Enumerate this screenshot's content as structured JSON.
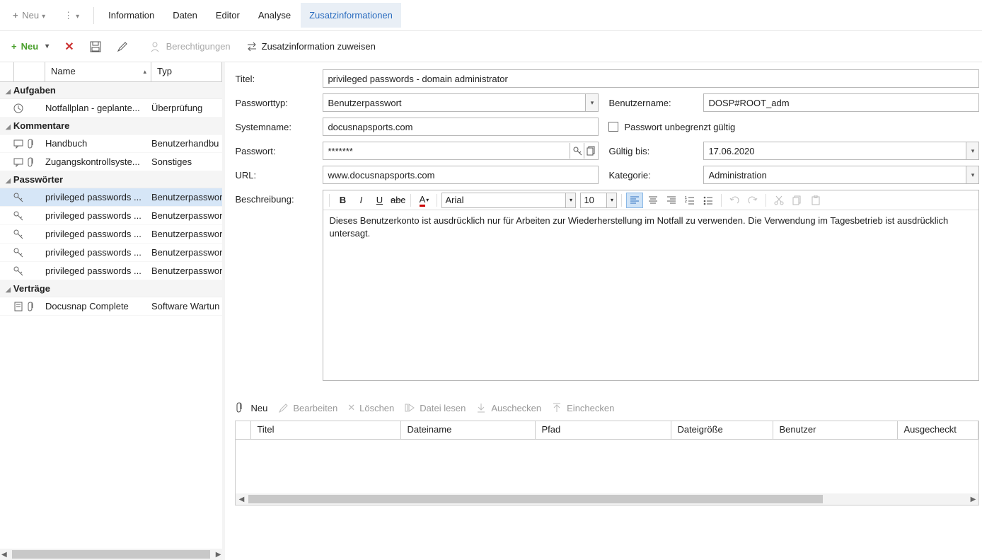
{
  "menubar": {
    "neu": "Neu",
    "information": "Information",
    "daten": "Daten",
    "editor": "Editor",
    "analyse": "Analyse",
    "zusatz": "Zusatzinformationen"
  },
  "toolbar": {
    "neu": "Neu",
    "berechtigungen": "Berechtigungen",
    "zuweisen": "Zusatzinformation zuweisen"
  },
  "sidebar": {
    "headers": {
      "name": "Name",
      "typ": "Typ"
    },
    "groups": {
      "aufgaben": "Aufgaben",
      "kommentare": "Kommentare",
      "passwoerter": "Passwörter",
      "vertraege": "Verträge"
    },
    "items": {
      "notfall": {
        "name": "Notfallplan - geplante...",
        "typ": "Überprüfung"
      },
      "handbuch": {
        "name": "Handbuch",
        "typ": "Benutzerhandbu"
      },
      "zugang": {
        "name": "Zugangskontrollsyste...",
        "typ": "Sonstiges"
      },
      "pw1": {
        "name": "privileged passwords ...",
        "typ": "Benutzerpasswor"
      },
      "pw2": {
        "name": "privileged passwords ...",
        "typ": "Benutzerpasswor"
      },
      "pw3": {
        "name": "privileged passwords ...",
        "typ": "Benutzerpasswor"
      },
      "pw4": {
        "name": "privileged passwords ...",
        "typ": "Benutzerpasswor"
      },
      "pw5": {
        "name": "privileged passwords ...",
        "typ": "Benutzerpasswor"
      },
      "docusnap": {
        "name": "Docusnap Complete",
        "typ": "Software Wartun"
      }
    }
  },
  "form": {
    "labels": {
      "titel": "Titel:",
      "pwtyp": "Passworttyp:",
      "systemname": "Systemname:",
      "passwort": "Passwort:",
      "url": "URL:",
      "beschreibung": "Beschreibung:",
      "benutzer": "Benutzername:",
      "unbegrenzt": "Passwort unbegrenzt gültig",
      "gueltig": "Gültig bis:",
      "kategorie": "Kategorie:"
    },
    "values": {
      "titel": "privileged passwords - domain administrator",
      "pwtyp": "Benutzerpasswort",
      "systemname": "docusnapsports.com",
      "passwort": "*******",
      "url": "www.docusnapsports.com",
      "benutzer": "DOSP#ROOT_adm",
      "gueltig": "17.06.2020",
      "kategorie": "Administration"
    }
  },
  "editor": {
    "font": "Arial",
    "size": "10",
    "content": "Dieses Benutzerkonto ist ausdrücklich nur für Arbeiten zur Wiederherstellung im Notfall zu verwenden.  Die Verwendung im Tagesbetrieb ist ausdrücklich untersagt."
  },
  "attach": {
    "neu": "Neu",
    "bearbeiten": "Bearbeiten",
    "loeschen": "Löschen",
    "lesen": "Datei lesen",
    "auschecken": "Auschecken",
    "einchecken": "Einchecken",
    "headers": {
      "titel": "Titel",
      "datei": "Dateiname",
      "pfad": "Pfad",
      "groesse": "Dateigröße",
      "benutzer": "Benutzer",
      "ausgecheckt": "Ausgecheckt"
    }
  }
}
